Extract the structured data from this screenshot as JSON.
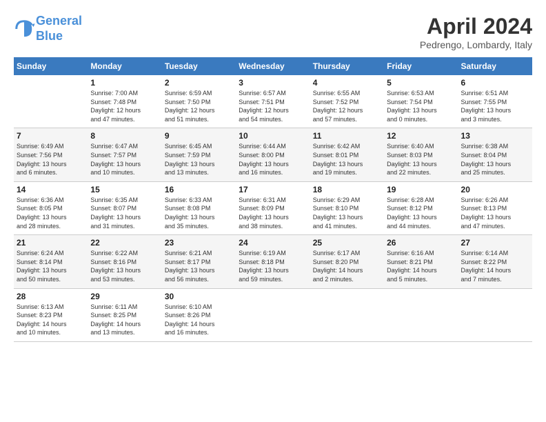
{
  "header": {
    "logo_line1": "General",
    "logo_line2": "Blue",
    "month": "April 2024",
    "location": "Pedrengo, Lombardy, Italy"
  },
  "days_of_week": [
    "Sunday",
    "Monday",
    "Tuesday",
    "Wednesday",
    "Thursday",
    "Friday",
    "Saturday"
  ],
  "weeks": [
    [
      {
        "day": "",
        "info": ""
      },
      {
        "day": "1",
        "info": "Sunrise: 7:00 AM\nSunset: 7:48 PM\nDaylight: 12 hours\nand 47 minutes."
      },
      {
        "day": "2",
        "info": "Sunrise: 6:59 AM\nSunset: 7:50 PM\nDaylight: 12 hours\nand 51 minutes."
      },
      {
        "day": "3",
        "info": "Sunrise: 6:57 AM\nSunset: 7:51 PM\nDaylight: 12 hours\nand 54 minutes."
      },
      {
        "day": "4",
        "info": "Sunrise: 6:55 AM\nSunset: 7:52 PM\nDaylight: 12 hours\nand 57 minutes."
      },
      {
        "day": "5",
        "info": "Sunrise: 6:53 AM\nSunset: 7:54 PM\nDaylight: 13 hours\nand 0 minutes."
      },
      {
        "day": "6",
        "info": "Sunrise: 6:51 AM\nSunset: 7:55 PM\nDaylight: 13 hours\nand 3 minutes."
      }
    ],
    [
      {
        "day": "7",
        "info": "Sunrise: 6:49 AM\nSunset: 7:56 PM\nDaylight: 13 hours\nand 6 minutes."
      },
      {
        "day": "8",
        "info": "Sunrise: 6:47 AM\nSunset: 7:57 PM\nDaylight: 13 hours\nand 10 minutes."
      },
      {
        "day": "9",
        "info": "Sunrise: 6:45 AM\nSunset: 7:59 PM\nDaylight: 13 hours\nand 13 minutes."
      },
      {
        "day": "10",
        "info": "Sunrise: 6:44 AM\nSunset: 8:00 PM\nDaylight: 13 hours\nand 16 minutes."
      },
      {
        "day": "11",
        "info": "Sunrise: 6:42 AM\nSunset: 8:01 PM\nDaylight: 13 hours\nand 19 minutes."
      },
      {
        "day": "12",
        "info": "Sunrise: 6:40 AM\nSunset: 8:03 PM\nDaylight: 13 hours\nand 22 minutes."
      },
      {
        "day": "13",
        "info": "Sunrise: 6:38 AM\nSunset: 8:04 PM\nDaylight: 13 hours\nand 25 minutes."
      }
    ],
    [
      {
        "day": "14",
        "info": "Sunrise: 6:36 AM\nSunset: 8:05 PM\nDaylight: 13 hours\nand 28 minutes."
      },
      {
        "day": "15",
        "info": "Sunrise: 6:35 AM\nSunset: 8:07 PM\nDaylight: 13 hours\nand 31 minutes."
      },
      {
        "day": "16",
        "info": "Sunrise: 6:33 AM\nSunset: 8:08 PM\nDaylight: 13 hours\nand 35 minutes."
      },
      {
        "day": "17",
        "info": "Sunrise: 6:31 AM\nSunset: 8:09 PM\nDaylight: 13 hours\nand 38 minutes."
      },
      {
        "day": "18",
        "info": "Sunrise: 6:29 AM\nSunset: 8:10 PM\nDaylight: 13 hours\nand 41 minutes."
      },
      {
        "day": "19",
        "info": "Sunrise: 6:28 AM\nSunset: 8:12 PM\nDaylight: 13 hours\nand 44 minutes."
      },
      {
        "day": "20",
        "info": "Sunrise: 6:26 AM\nSunset: 8:13 PM\nDaylight: 13 hours\nand 47 minutes."
      }
    ],
    [
      {
        "day": "21",
        "info": "Sunrise: 6:24 AM\nSunset: 8:14 PM\nDaylight: 13 hours\nand 50 minutes."
      },
      {
        "day": "22",
        "info": "Sunrise: 6:22 AM\nSunset: 8:16 PM\nDaylight: 13 hours\nand 53 minutes."
      },
      {
        "day": "23",
        "info": "Sunrise: 6:21 AM\nSunset: 8:17 PM\nDaylight: 13 hours\nand 56 minutes."
      },
      {
        "day": "24",
        "info": "Sunrise: 6:19 AM\nSunset: 8:18 PM\nDaylight: 13 hours\nand 59 minutes."
      },
      {
        "day": "25",
        "info": "Sunrise: 6:17 AM\nSunset: 8:20 PM\nDaylight: 14 hours\nand 2 minutes."
      },
      {
        "day": "26",
        "info": "Sunrise: 6:16 AM\nSunset: 8:21 PM\nDaylight: 14 hours\nand 5 minutes."
      },
      {
        "day": "27",
        "info": "Sunrise: 6:14 AM\nSunset: 8:22 PM\nDaylight: 14 hours\nand 7 minutes."
      }
    ],
    [
      {
        "day": "28",
        "info": "Sunrise: 6:13 AM\nSunset: 8:23 PM\nDaylight: 14 hours\nand 10 minutes."
      },
      {
        "day": "29",
        "info": "Sunrise: 6:11 AM\nSunset: 8:25 PM\nDaylight: 14 hours\nand 13 minutes."
      },
      {
        "day": "30",
        "info": "Sunrise: 6:10 AM\nSunset: 8:26 PM\nDaylight: 14 hours\nand 16 minutes."
      },
      {
        "day": "",
        "info": ""
      },
      {
        "day": "",
        "info": ""
      },
      {
        "day": "",
        "info": ""
      },
      {
        "day": "",
        "info": ""
      }
    ]
  ]
}
